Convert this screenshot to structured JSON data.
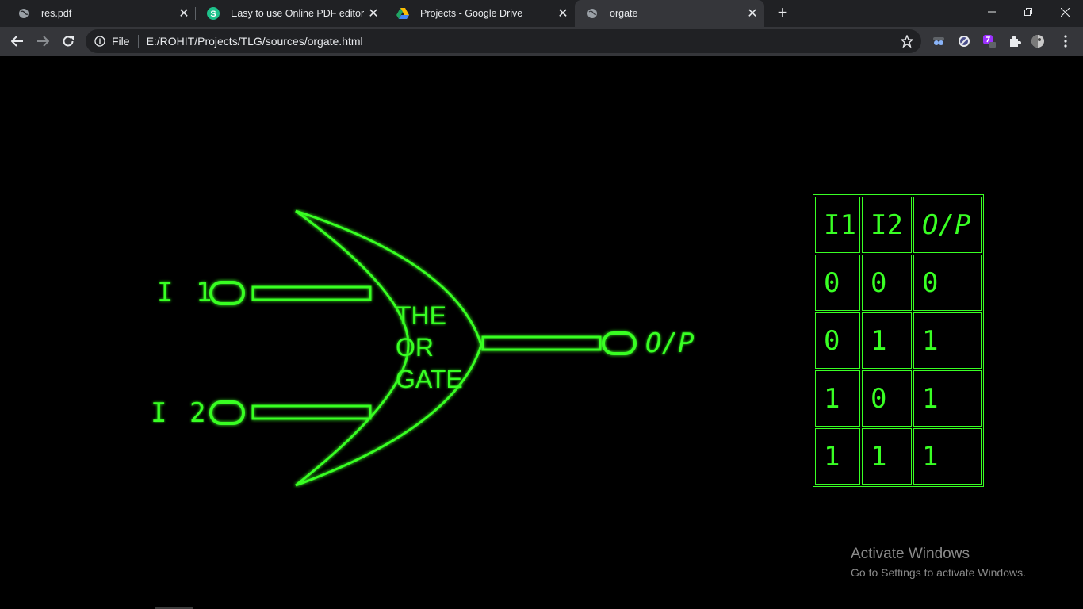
{
  "tabs": [
    {
      "title": "res.pdf",
      "icon": "globe-icon",
      "active": false
    },
    {
      "title": "Easy to use Online PDF editor",
      "icon": "sejda-icon",
      "active": false
    },
    {
      "title": "Projects - Google Drive",
      "icon": "google-drive-icon",
      "active": false
    },
    {
      "title": "orgate",
      "icon": "globe-icon",
      "active": true
    }
  ],
  "toolbar": {
    "scheme_label": "File",
    "url": "E:/ROHIT/Projects/TLG/sources/orgate.html"
  },
  "gate": {
    "label_lines": [
      "THE",
      "OR",
      "GATE"
    ],
    "input1": "I 1",
    "input2": "I 2",
    "output": "O/P",
    "color": "#39ff24"
  },
  "truth_table": {
    "headers": [
      "I1",
      "I2",
      "O/P"
    ],
    "rows": [
      [
        "0",
        "0",
        "0"
      ],
      [
        "0",
        "1",
        "1"
      ],
      [
        "1",
        "0",
        "1"
      ],
      [
        "1",
        "1",
        "1"
      ]
    ]
  },
  "watermark": {
    "line1": "Activate Windows",
    "line2": "Go to Settings to activate Windows."
  }
}
